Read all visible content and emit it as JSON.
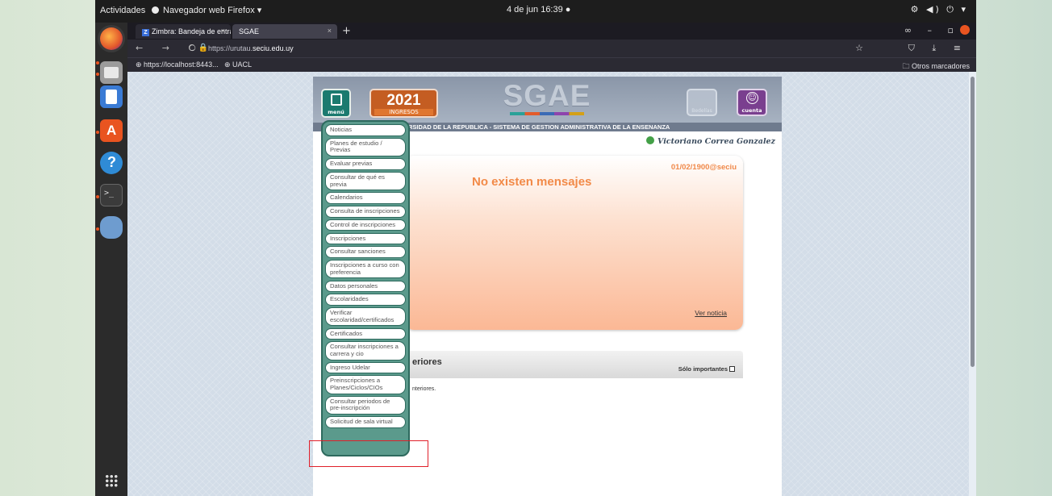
{
  "topbar": {
    "activities": "Actividades",
    "app_name": "Navegador web Firefox ▾",
    "clock": "4 de jun  16:39  ●",
    "system_icons": "⚙ ◀) ⏻ ▾"
  },
  "browser": {
    "tabs": [
      {
        "label": "Zimbra: Bandeja de entra",
        "close": "×"
      },
      {
        "label": "SGAE",
        "close": "×"
      }
    ],
    "new_tab": "+",
    "window_controls": "∞ – ▫",
    "nav": "← → C",
    "url_host_prefix": "https://urutau.",
    "url_host_main": "seciu.edu.uy",
    "url_icons": "○ 🔒",
    "star": "☆",
    "toolbar_right": "⛉ ⤓ ≡",
    "bookmarks": [
      {
        "label": "⊕ https://localhost:8443..."
      },
      {
        "label": "⊕ UACL"
      }
    ],
    "other_bookmarks": "🗀 Otros marcadores"
  },
  "sgae": {
    "menu_label": "menú",
    "year": "2021",
    "year_sub": "INGRESOS",
    "logo": "SGAE",
    "bedelias_label": "Bedelías",
    "cuenta_label": "cuenta",
    "header_strip": "RSIDAD DE LA REPUBLICA - SISTEMA DE GESTION ADMINISTRATIVA DE LA ENSENANZA",
    "user_name": "Victoriano Correa Gonzalez",
    "message_date": "01/02/1900@seciu",
    "no_messages": "No existen mensajes",
    "see_news": "Ver noticia",
    "previous_title": "eriores",
    "only_important": "Sólo importantes",
    "previous_text": "nteriores."
  },
  "menu_items": [
    "Noticias",
    "Planes de estudio / Previas",
    "Evaluar previas",
    "Consultar de qué es previa",
    "Calendarios",
    "Consulta de inscripciones",
    "Control de inscripciones",
    "Inscripciones",
    "Consultar sanciones",
    "Inscripciones a curso con preferencia",
    "Datos personales",
    "Escolaridades",
    "Verificar escolaridad/certificados",
    "Certificados",
    "Consultar inscripciones a carrera y cio",
    "Ingreso Udelar",
    "Preinscripciones a Planes/Ciclos/CIOs",
    "Consultar periodos de pre-inscripción",
    "Solicitud de sala virtual"
  ],
  "colors": {
    "highlight": "#e0202a",
    "menu_teal": "#1b7a6f",
    "year_orange": "#c45d22",
    "message_orange": "#f28a48"
  }
}
